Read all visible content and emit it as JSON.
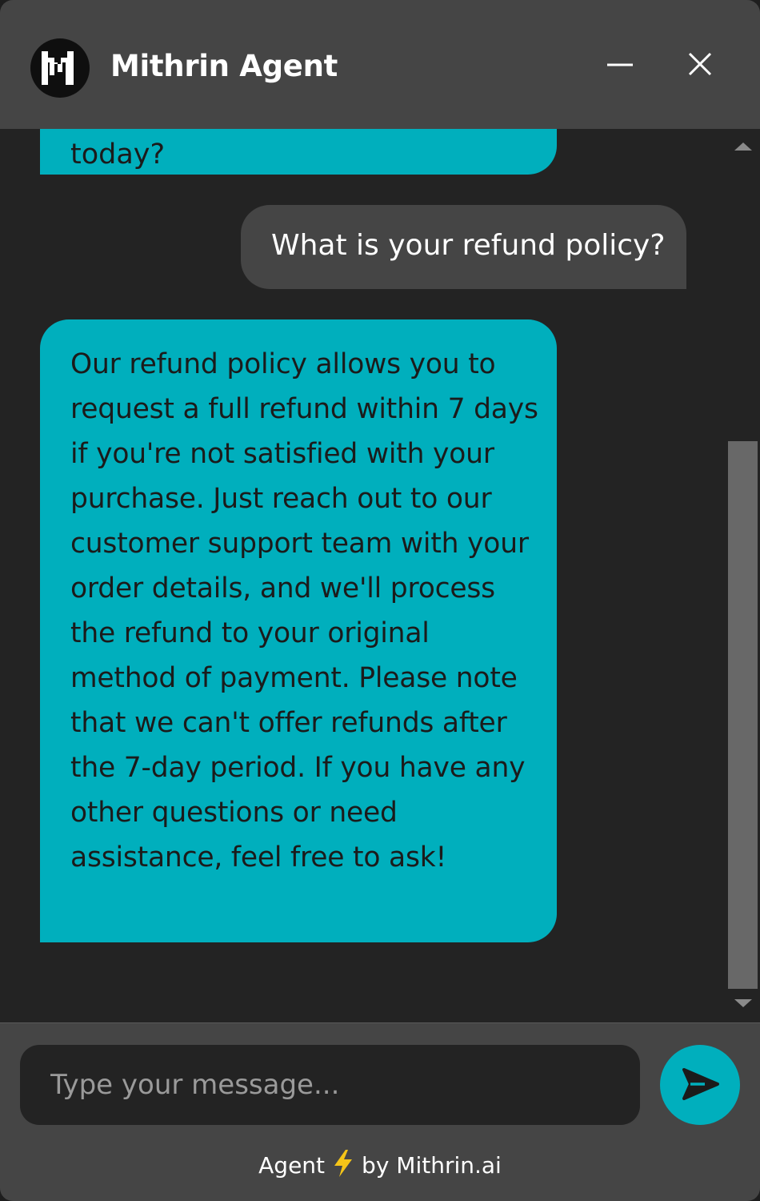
{
  "header": {
    "title": "Mithrin Agent",
    "logo_icon": "mithrin-logo-icon",
    "minimize_icon": "minimize-icon",
    "close_icon": "close-icon"
  },
  "messages": [
    {
      "role": "bot",
      "text": "today?"
    },
    {
      "role": "user",
      "text": "What is your refund policy?"
    },
    {
      "role": "bot",
      "text": "Our refund policy allows you to request a full refund within 7 days if you're not satisfied with your purchase. Just reach out to our customer support team with your order details, and we'll process the refund to your original method of payment. Please note that we can't offer refunds after the 7-day period. If you have any other questions or need assistance, feel free to ask!"
    }
  ],
  "composer": {
    "placeholder": "Type your message...",
    "value": "",
    "send_icon": "send-icon"
  },
  "branding": {
    "prefix": "Agent",
    "icon": "lightning-bolt-icon",
    "suffix": "by Mithrin.ai"
  },
  "colors": {
    "header_bg": "#454545",
    "chat_bg": "#232323",
    "bot_bubble": "#00afbd",
    "user_bubble": "#454545",
    "bolt": "#f5c518"
  }
}
